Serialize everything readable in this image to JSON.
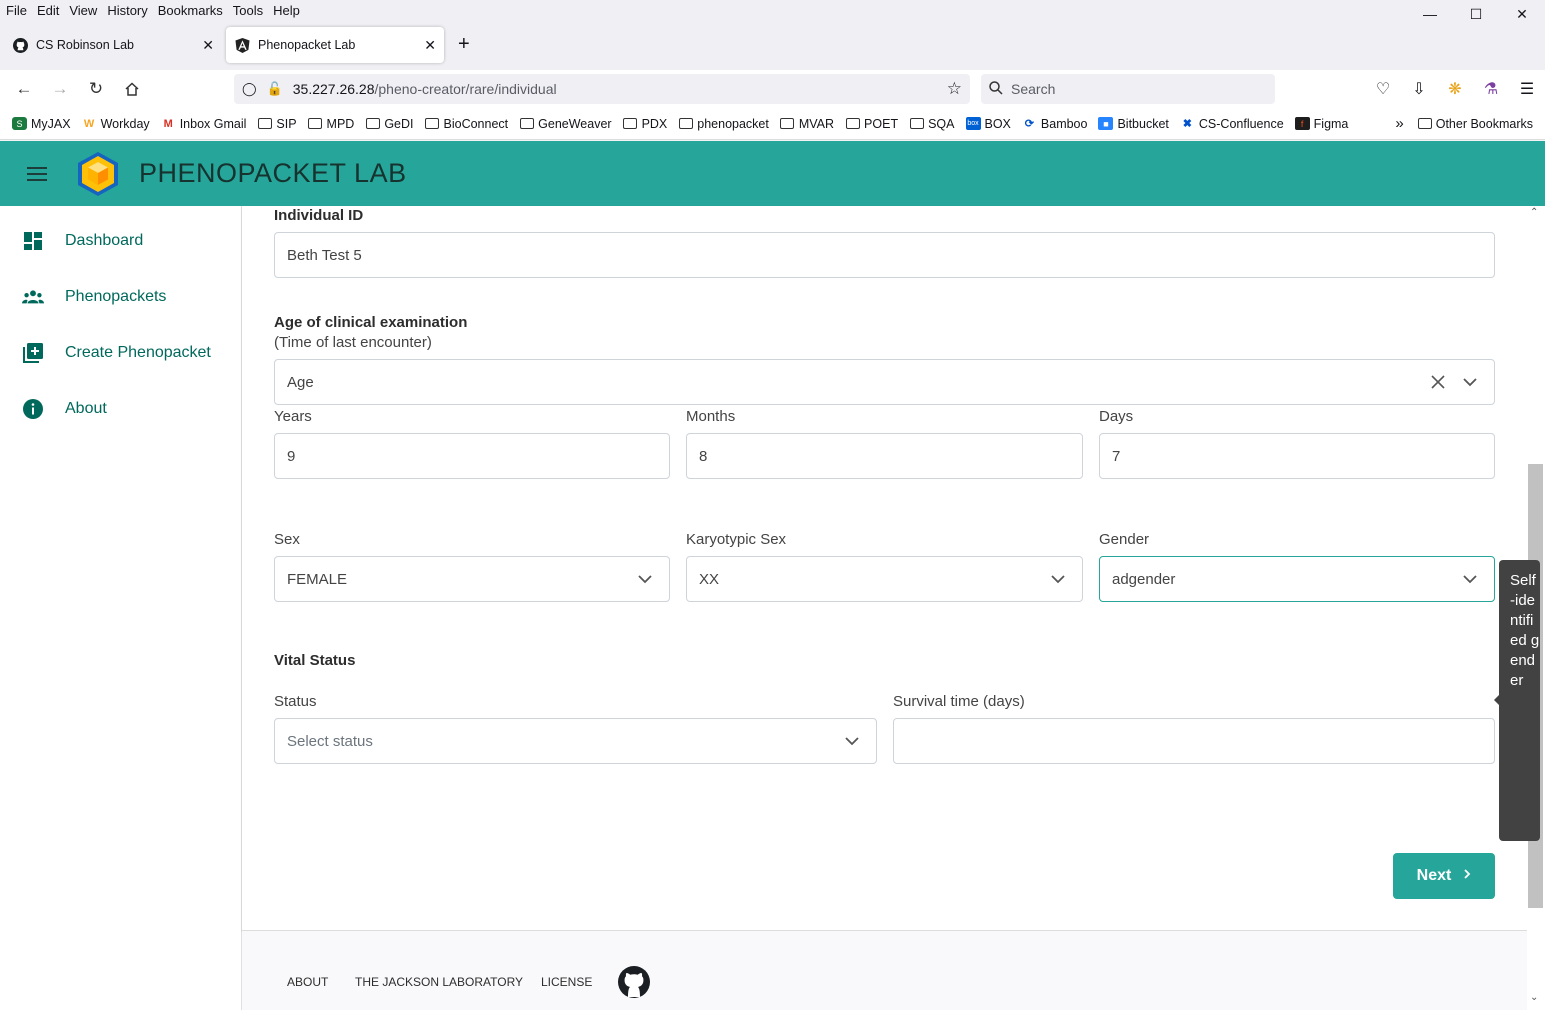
{
  "menubar": {
    "items": [
      "File",
      "Edit",
      "View",
      "History",
      "Bookmarks",
      "Tools",
      "Help"
    ]
  },
  "tabs": [
    {
      "title": "CS Robinson Lab"
    },
    {
      "title": "Phenopacket Lab"
    }
  ],
  "url": {
    "host": "35.227.26.28",
    "path": "/pheno-creator/rare/individual"
  },
  "search": {
    "placeholder": "Search"
  },
  "bookmarks": [
    "MyJAX",
    "Workday",
    "Inbox Gmail",
    "SIP",
    "MPD",
    "GeDI",
    "BioConnect",
    "GeneWeaver",
    "PDX",
    "phenopacket",
    "MVAR",
    "POET",
    "SQA",
    "BOX",
    "Bamboo",
    "Bitbucket",
    "CS-Confluence",
    "Figma"
  ],
  "bookmarks_other": "Other Bookmarks",
  "app": {
    "title": "PHENOPACKET LAB",
    "accent": "#26a69a"
  },
  "sidebar": {
    "items": [
      {
        "label": "Dashboard",
        "icon": "dashboard-icon"
      },
      {
        "label": "Phenopackets",
        "icon": "people-icon"
      },
      {
        "label": "Create Phenopacket",
        "icon": "add-box-icon"
      },
      {
        "label": "About",
        "icon": "info-icon"
      }
    ]
  },
  "form": {
    "individual_id_label": "Individual ID",
    "individual_id_value": "Beth Test 5",
    "age_label": "Age of clinical examination",
    "age_sublabel": "(Time of last encounter)",
    "age_type_value": "Age",
    "years_label": "Years",
    "years_value": "9",
    "months_label": "Months",
    "months_value": "8",
    "days_label": "Days",
    "days_value": "7",
    "sex_label": "Sex",
    "sex_value": "FEMALE",
    "karyotypic_label": "Karyotypic Sex",
    "karyotypic_value": "XX",
    "gender_label": "Gender",
    "gender_value": "adgender",
    "vital_status_label": "Vital Status",
    "status_label": "Status",
    "status_placeholder": "Select status",
    "survival_label": "Survival time (days)",
    "survival_value": "",
    "next_label": "Next"
  },
  "tooltip": "Self-identified gender",
  "footer": {
    "items": [
      "ABOUT",
      "THE JACKSON LABORATORY",
      "LICENSE"
    ]
  }
}
